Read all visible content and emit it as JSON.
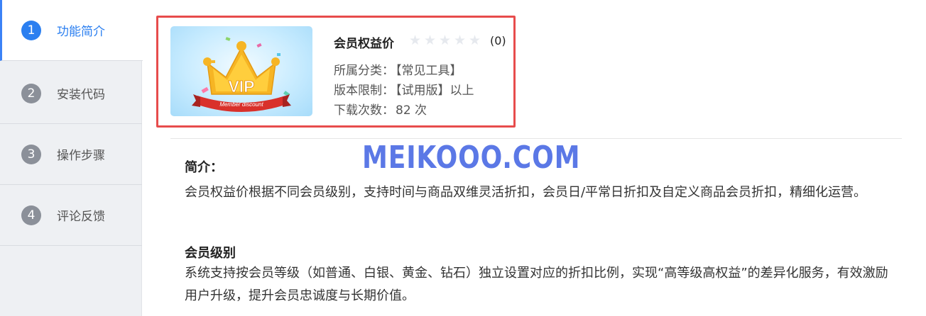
{
  "sidebar": {
    "items": [
      {
        "num": "1",
        "label": "功能简介",
        "active": true
      },
      {
        "num": "2",
        "label": "安装代码"
      },
      {
        "num": "3",
        "label": "操作步骤"
      },
      {
        "num": "4",
        "label": "评论反馈"
      }
    ]
  },
  "product": {
    "image_text": {
      "vip": "VIP",
      "ribbon": "Member discount"
    },
    "title": "会员权益价",
    "rating_stars": 0,
    "rating_count": "(0)",
    "category_label": "所属分类：",
    "category_value": "【常见工具】",
    "version_label": "版本限制：",
    "version_value": "【试用版】以上",
    "downloads_label": "下载次数：",
    "downloads_value": "82 次"
  },
  "watermark": "MEIKOOO.COM",
  "content": {
    "intro_title": "简介：",
    "intro_text": "会员权益价根据不同会员级别，支持时间与商品双维灵活折扣，会员日/平常日折扣及自定义商品会员折扣，精细化运营。",
    "level_title": "会员级别",
    "level_text": "系统支持按会员等级（如普通、白银、黄金、钻石）独立设置对应的折扣比例，实现“高等级高权益”的差异化服务，有效激励用户升级，提升会员忠诚度与长期价值。"
  },
  "colors": {
    "accent": "#2b7ff0",
    "highlight_border": "#e74c4c",
    "watermark": "#5b78e6"
  }
}
